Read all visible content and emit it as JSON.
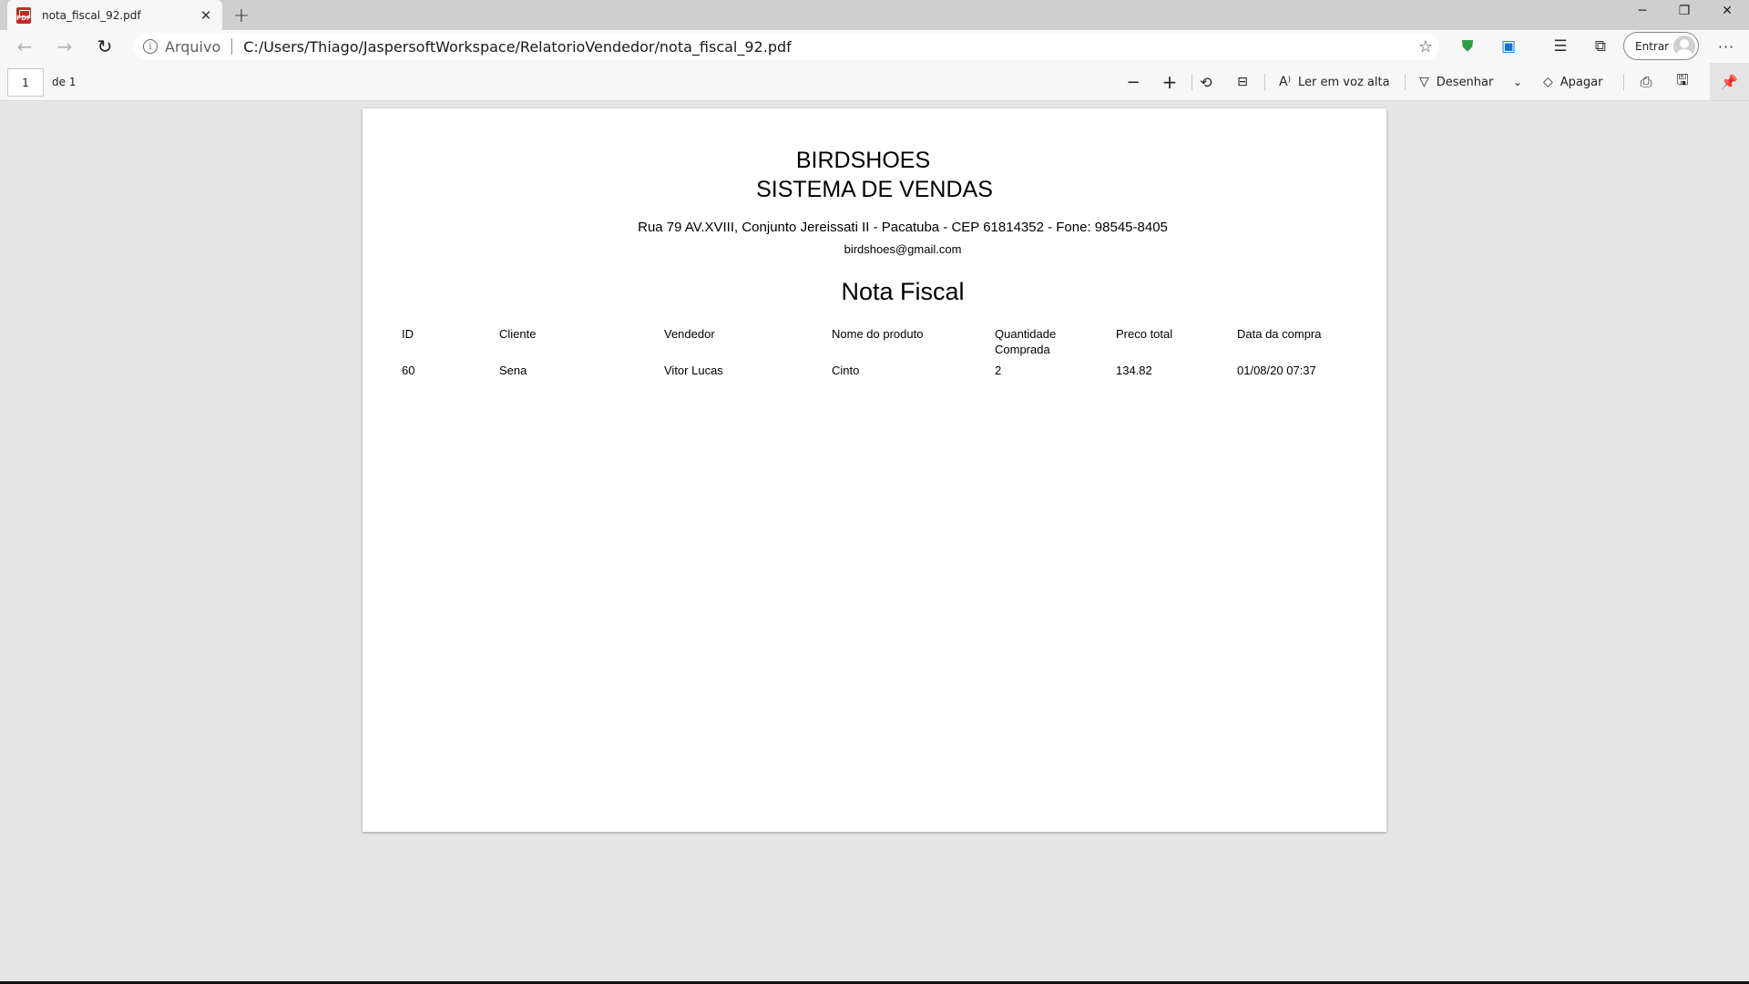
{
  "browser": {
    "tab_title": "nota_fiscal_92.pdf",
    "tab_icon": "PDF",
    "address_scheme": "Arquivo",
    "url": "C:/Users/Thiago/JaspersoftWorkspace/RelatorioVendedor/nota_fiscal_92.pdf",
    "signin_label": "Entrar"
  },
  "pdf_toolbar": {
    "page_number": "1",
    "page_total": "de 1",
    "read_aloud_label": "Ler em voz alta",
    "draw_label": "Desenhar",
    "erase_label": "Apagar"
  },
  "document": {
    "company_line1": "BIRDSHOES",
    "company_line2": "SISTEMA DE VENDAS",
    "address": "Rua 79 AV.XVIII, Conjunto Jereissati II - Pacatuba - CEP 61814352 - Fone: 98545-8405",
    "email": "birdshoes@gmail.com",
    "title": "Nota Fiscal",
    "headers": {
      "id": "ID",
      "cliente": "Cliente",
      "vendedor": "Vendedor",
      "produto": "Nome do produto",
      "quantidade_1": "Quantidade",
      "quantidade_2": "Comprada",
      "preco": "Preco total",
      "data": "Data da compra"
    },
    "row": {
      "id": "60",
      "cliente": "Sena",
      "vendedor": "Vitor Lucas",
      "produto": "Cinto",
      "quantidade": "2",
      "preco": "134.82",
      "data": "01/08/20 07:37"
    }
  },
  "colors": {
    "pdf_icon": "#c62828",
    "shield_icon": "#2e9d47",
    "collections_icon": "#1a73c9",
    "viewer_background": "#e6e6e6"
  }
}
